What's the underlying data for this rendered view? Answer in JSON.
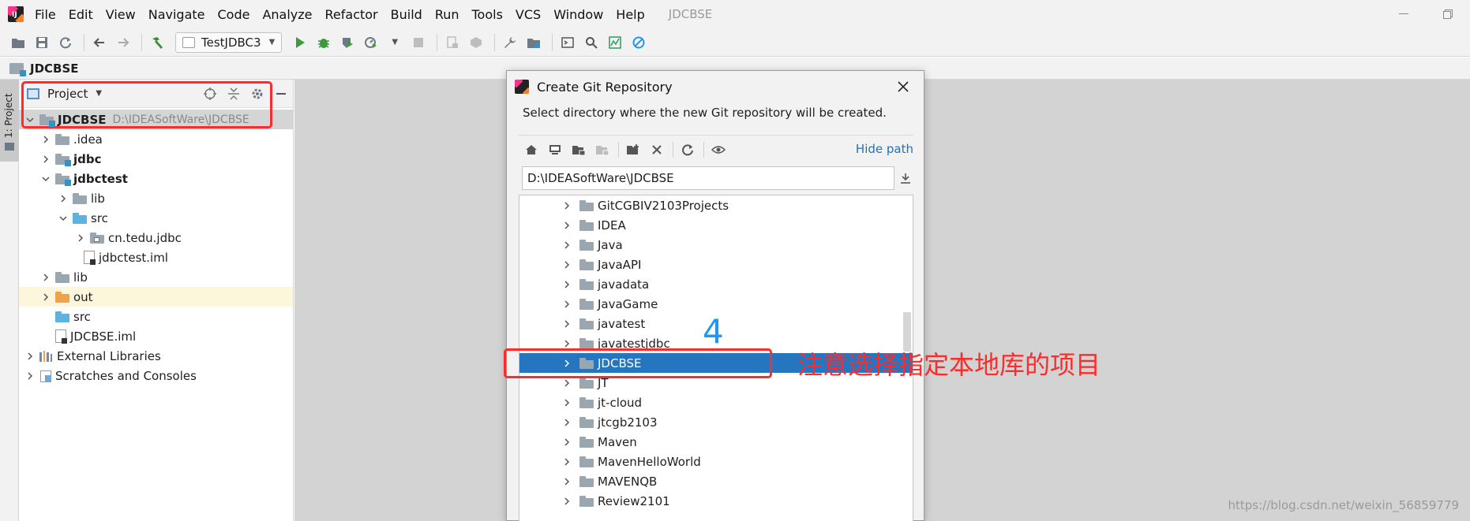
{
  "menubar": {
    "items": [
      "File",
      "Edit",
      "View",
      "Navigate",
      "Code",
      "Analyze",
      "Refactor",
      "Build",
      "Run",
      "Tools",
      "VCS",
      "Window",
      "Help"
    ],
    "title": "JDCBSE"
  },
  "toolbar": {
    "run_config": "TestJDBC3"
  },
  "navbar": {
    "project": "JDCBSE"
  },
  "left_stripe": {
    "tab_label": "1: Project"
  },
  "project_panel": {
    "title": "Project",
    "tree": [
      {
        "label": "JDCBSE",
        "path": "D:\\IDEASoftWare\\JDCBSE"
      },
      {
        "label": ".idea"
      },
      {
        "label": "jdbc"
      },
      {
        "label": "jdbctest"
      },
      {
        "label": "lib"
      },
      {
        "label": "src"
      },
      {
        "label": "cn.tedu.jdbc"
      },
      {
        "label": "jdbctest.iml"
      },
      {
        "label": "lib"
      },
      {
        "label": "out"
      },
      {
        "label": "src"
      },
      {
        "label": "JDCBSE.iml"
      },
      {
        "label": "External Libraries"
      },
      {
        "label": "Scratches and Consoles"
      }
    ]
  },
  "dialog": {
    "title": "Create Git Repository",
    "description": "Select directory where the new Git repository will be created.",
    "hide_path": "Hide path",
    "path_value": "D:\\IDEASoftWare\\JDCBSE",
    "directories": [
      "GitCGBIV2103Projects",
      "IDEA",
      "Java",
      "JavaAPI",
      "javadata",
      "JavaGame",
      "javatest",
      "javatestjdbc",
      "JDCBSE",
      "JT",
      "jt-cloud",
      "jtcgb2103",
      "Maven",
      "MavenHelloWorld",
      "MAVENQB",
      "Review2101"
    ]
  },
  "annotations": {
    "step": "4",
    "note": "注意选择指定本地库的项目"
  },
  "watermark": "https://blog.csdn.net/weixin_56859779"
}
